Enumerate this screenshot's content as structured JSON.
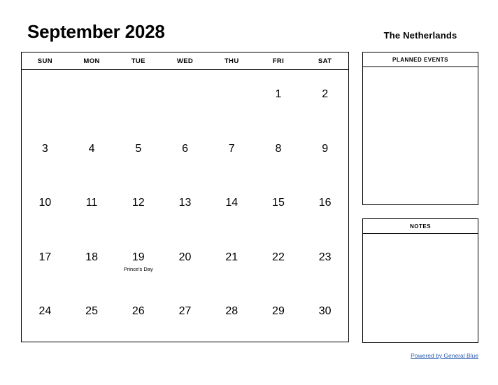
{
  "page_title": "September 2028",
  "country_title": "The Netherlands",
  "calendar": {
    "month": "September",
    "year": "2028",
    "weekday_headers": [
      "SUN",
      "MON",
      "TUE",
      "WED",
      "THU",
      "FRI",
      "SAT"
    ],
    "weeks": [
      [
        {
          "day": ""
        },
        {
          "day": ""
        },
        {
          "day": ""
        },
        {
          "day": ""
        },
        {
          "day": ""
        },
        {
          "day": "1"
        },
        {
          "day": "2"
        }
      ],
      [
        {
          "day": "3"
        },
        {
          "day": "4"
        },
        {
          "day": "5"
        },
        {
          "day": "6"
        },
        {
          "day": "7"
        },
        {
          "day": "8"
        },
        {
          "day": "9"
        }
      ],
      [
        {
          "day": "10"
        },
        {
          "day": "11"
        },
        {
          "day": "12"
        },
        {
          "day": "13"
        },
        {
          "day": "14"
        },
        {
          "day": "15"
        },
        {
          "day": "16"
        }
      ],
      [
        {
          "day": "17"
        },
        {
          "day": "18"
        },
        {
          "day": "19",
          "event": "Prince's Day"
        },
        {
          "day": "20"
        },
        {
          "day": "21"
        },
        {
          "day": "22"
        },
        {
          "day": "23"
        }
      ],
      [
        {
          "day": "24"
        },
        {
          "day": "25"
        },
        {
          "day": "26"
        },
        {
          "day": "27"
        },
        {
          "day": "28"
        },
        {
          "day": "29"
        },
        {
          "day": "30"
        }
      ]
    ]
  },
  "side_panels": [
    {
      "name": "planned-events",
      "header": "PLANNED EVENTS",
      "content": ""
    },
    {
      "name": "notes",
      "header": "NOTES",
      "content": ""
    }
  ],
  "footer": {
    "link_label": "Powered by General Blue",
    "link_color": "#2a5db0"
  }
}
